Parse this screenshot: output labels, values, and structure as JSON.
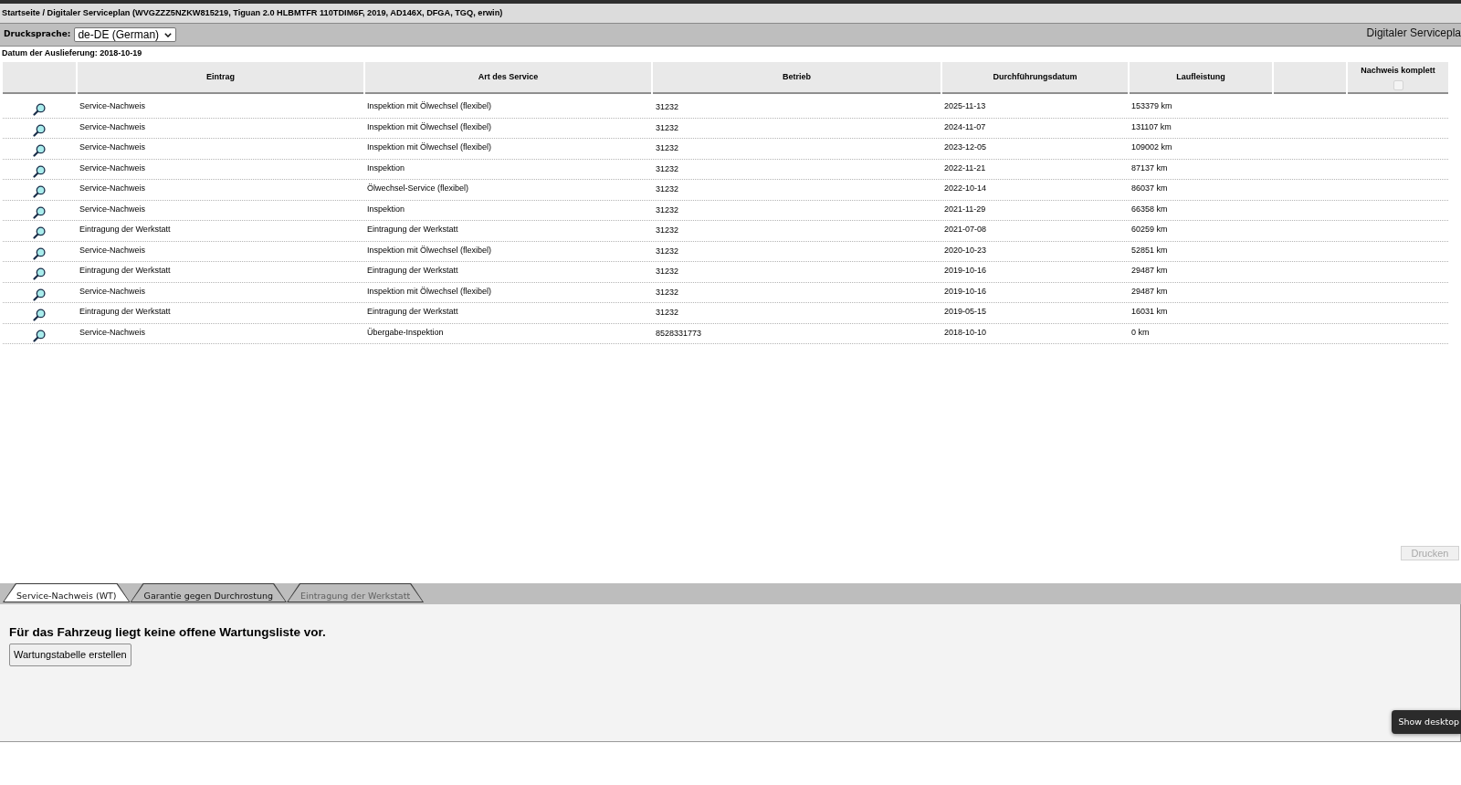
{
  "breadcrumb": "Startseite / Digitaler Serviceplan (WVGZZZ5NZKW815219, Tiguan 2.0 HLBMTFR 110TDIM6F, 2019, AD146X, DFGA, TGQ, erwin)",
  "toolbar": {
    "language_label": "Drucksprache:",
    "language_select": "de-DE (German)",
    "title": "Digitaler Servicepla"
  },
  "delivery_date": "Datum der Auslieferung: 2018-10-19",
  "table": {
    "columns": [
      "Eintrag",
      "Art des Service",
      "Betrieb",
      "Durchführungsdatum",
      "Laufleistung"
    ],
    "complete_column": {
      "label": "Nachweis komplett",
      "checked": false,
      "disabled": true
    },
    "rows": [
      {
        "entry": "Service-Nachweis",
        "service": "Inspektion mit Ölwechsel (flexibel)",
        "workshop": "31232",
        "date": "2025-11-13",
        "mileage": "153379 km"
      },
      {
        "entry": "Service-Nachweis",
        "service": "Inspektion mit Ölwechsel (flexibel)",
        "workshop": "31232",
        "date": "2024-11-07",
        "mileage": "131107 km"
      },
      {
        "entry": "Service-Nachweis",
        "service": "Inspektion mit Ölwechsel (flexibel)",
        "workshop": "31232",
        "date": "2023-12-05",
        "mileage": "109002 km"
      },
      {
        "entry": "Service-Nachweis",
        "service": "Inspektion",
        "workshop": "31232",
        "date": "2022-11-21",
        "mileage": "87137 km"
      },
      {
        "entry": "Service-Nachweis",
        "service": "Ölwechsel-Service (flexibel)",
        "workshop": "31232",
        "date": "2022-10-14",
        "mileage": "86037 km"
      },
      {
        "entry": "Service-Nachweis",
        "service": "Inspektion",
        "workshop": "31232",
        "date": "2021-11-29",
        "mileage": "66358 km"
      },
      {
        "entry": "Eintragung der Werkstatt",
        "service": "Eintragung der Werkstatt",
        "workshop": "31232",
        "date": "2021-07-08",
        "mileage": "60259 km"
      },
      {
        "entry": "Service-Nachweis",
        "service": "Inspektion mit Ölwechsel (flexibel)",
        "workshop": "31232",
        "date": "2020-10-23",
        "mileage": "52851 km"
      },
      {
        "entry": "Eintragung der Werkstatt",
        "service": "Eintragung der Werkstatt",
        "workshop": "31232",
        "date": "2019-10-16",
        "mileage": "29487 km"
      },
      {
        "entry": "Service-Nachweis",
        "service": "Inspektion mit Ölwechsel (flexibel)",
        "workshop": "31232",
        "date": "2019-10-16",
        "mileage": "29487 km"
      },
      {
        "entry": "Eintragung der Werkstatt",
        "service": "Eintragung der Werkstatt",
        "workshop": "31232",
        "date": "2019-05-15",
        "mileage": "16031 km"
      },
      {
        "entry": "Service-Nachweis",
        "service": "Übergabe-Inspektion",
        "workshop": "8528331773",
        "date": "2018-10-10",
        "mileage": "0 km"
      }
    ]
  },
  "print_button": {
    "label": "Drucken",
    "disabled": true
  },
  "tabs": [
    {
      "label": "Service-Nachweis (WT)",
      "selected": true,
      "disabled": false
    },
    {
      "label": "Garantie gegen Durchrostung",
      "selected": false,
      "disabled": false
    },
    {
      "label": "Eintragung der Werkstatt",
      "selected": false,
      "disabled": true
    }
  ],
  "panel": {
    "message": "Für das Fahrzeug liegt keine offene Wartungsliste vor.",
    "button": "Wartungstabelle erstellen"
  },
  "tooltip": "Show desktop"
}
